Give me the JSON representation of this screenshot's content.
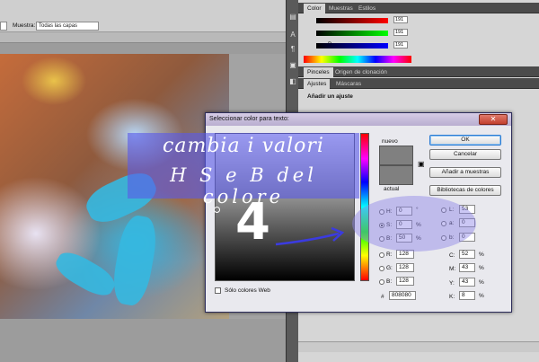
{
  "options_bar": {
    "sample_label": "Muestra:",
    "sample_value": "Todas las capas"
  },
  "panels": {
    "color_tabs": [
      "Color",
      "Muestras",
      "Estilos"
    ],
    "color_values": [
      "191",
      "191",
      "191"
    ],
    "brush_tabs": [
      "Pinceles",
      "Origen de clonación"
    ],
    "adjust_tabs": [
      "Ajustes",
      "Máscaras"
    ],
    "adjust_title": "Añadir un ajuste",
    "b_label": "B"
  },
  "dialog": {
    "title": "Seleccionar color para texto:",
    "close": "✕",
    "new_label": "nuevo",
    "current_label": "actual",
    "ok": "OK",
    "cancel": "Cancelar",
    "add_swatches": "Añadir a muestras",
    "libraries": "Bibliotecas de colores",
    "web_only": "Sólo colores Web",
    "hsb": [
      {
        "label": "H:",
        "value": "0",
        "unit": "°"
      },
      {
        "label": "S:",
        "value": "0",
        "unit": "%"
      },
      {
        "label": "B:",
        "value": "50",
        "unit": "%"
      }
    ],
    "rgb": [
      {
        "label": "R:",
        "value": "128"
      },
      {
        "label": "G:",
        "value": "128"
      },
      {
        "label": "B:",
        "value": "128"
      }
    ],
    "lab": [
      {
        "label": "L:",
        "value": "53"
      },
      {
        "label": "a:",
        "value": "0"
      },
      {
        "label": "b:",
        "value": "0"
      }
    ],
    "cmyk": [
      {
        "label": "C:",
        "value": "52",
        "unit": "%"
      },
      {
        "label": "M:",
        "value": "43",
        "unit": "%"
      },
      {
        "label": "Y:",
        "value": "43",
        "unit": "%"
      },
      {
        "label": "K:",
        "value": "8",
        "unit": "%"
      }
    ],
    "hex_label": "#",
    "hex_value": "808080",
    "swatch_color": "#808080"
  },
  "annotation": {
    "line1": "cambia i valori",
    "line2": "H S e B del colore",
    "number": "4",
    "color": "#5a5ae6"
  }
}
